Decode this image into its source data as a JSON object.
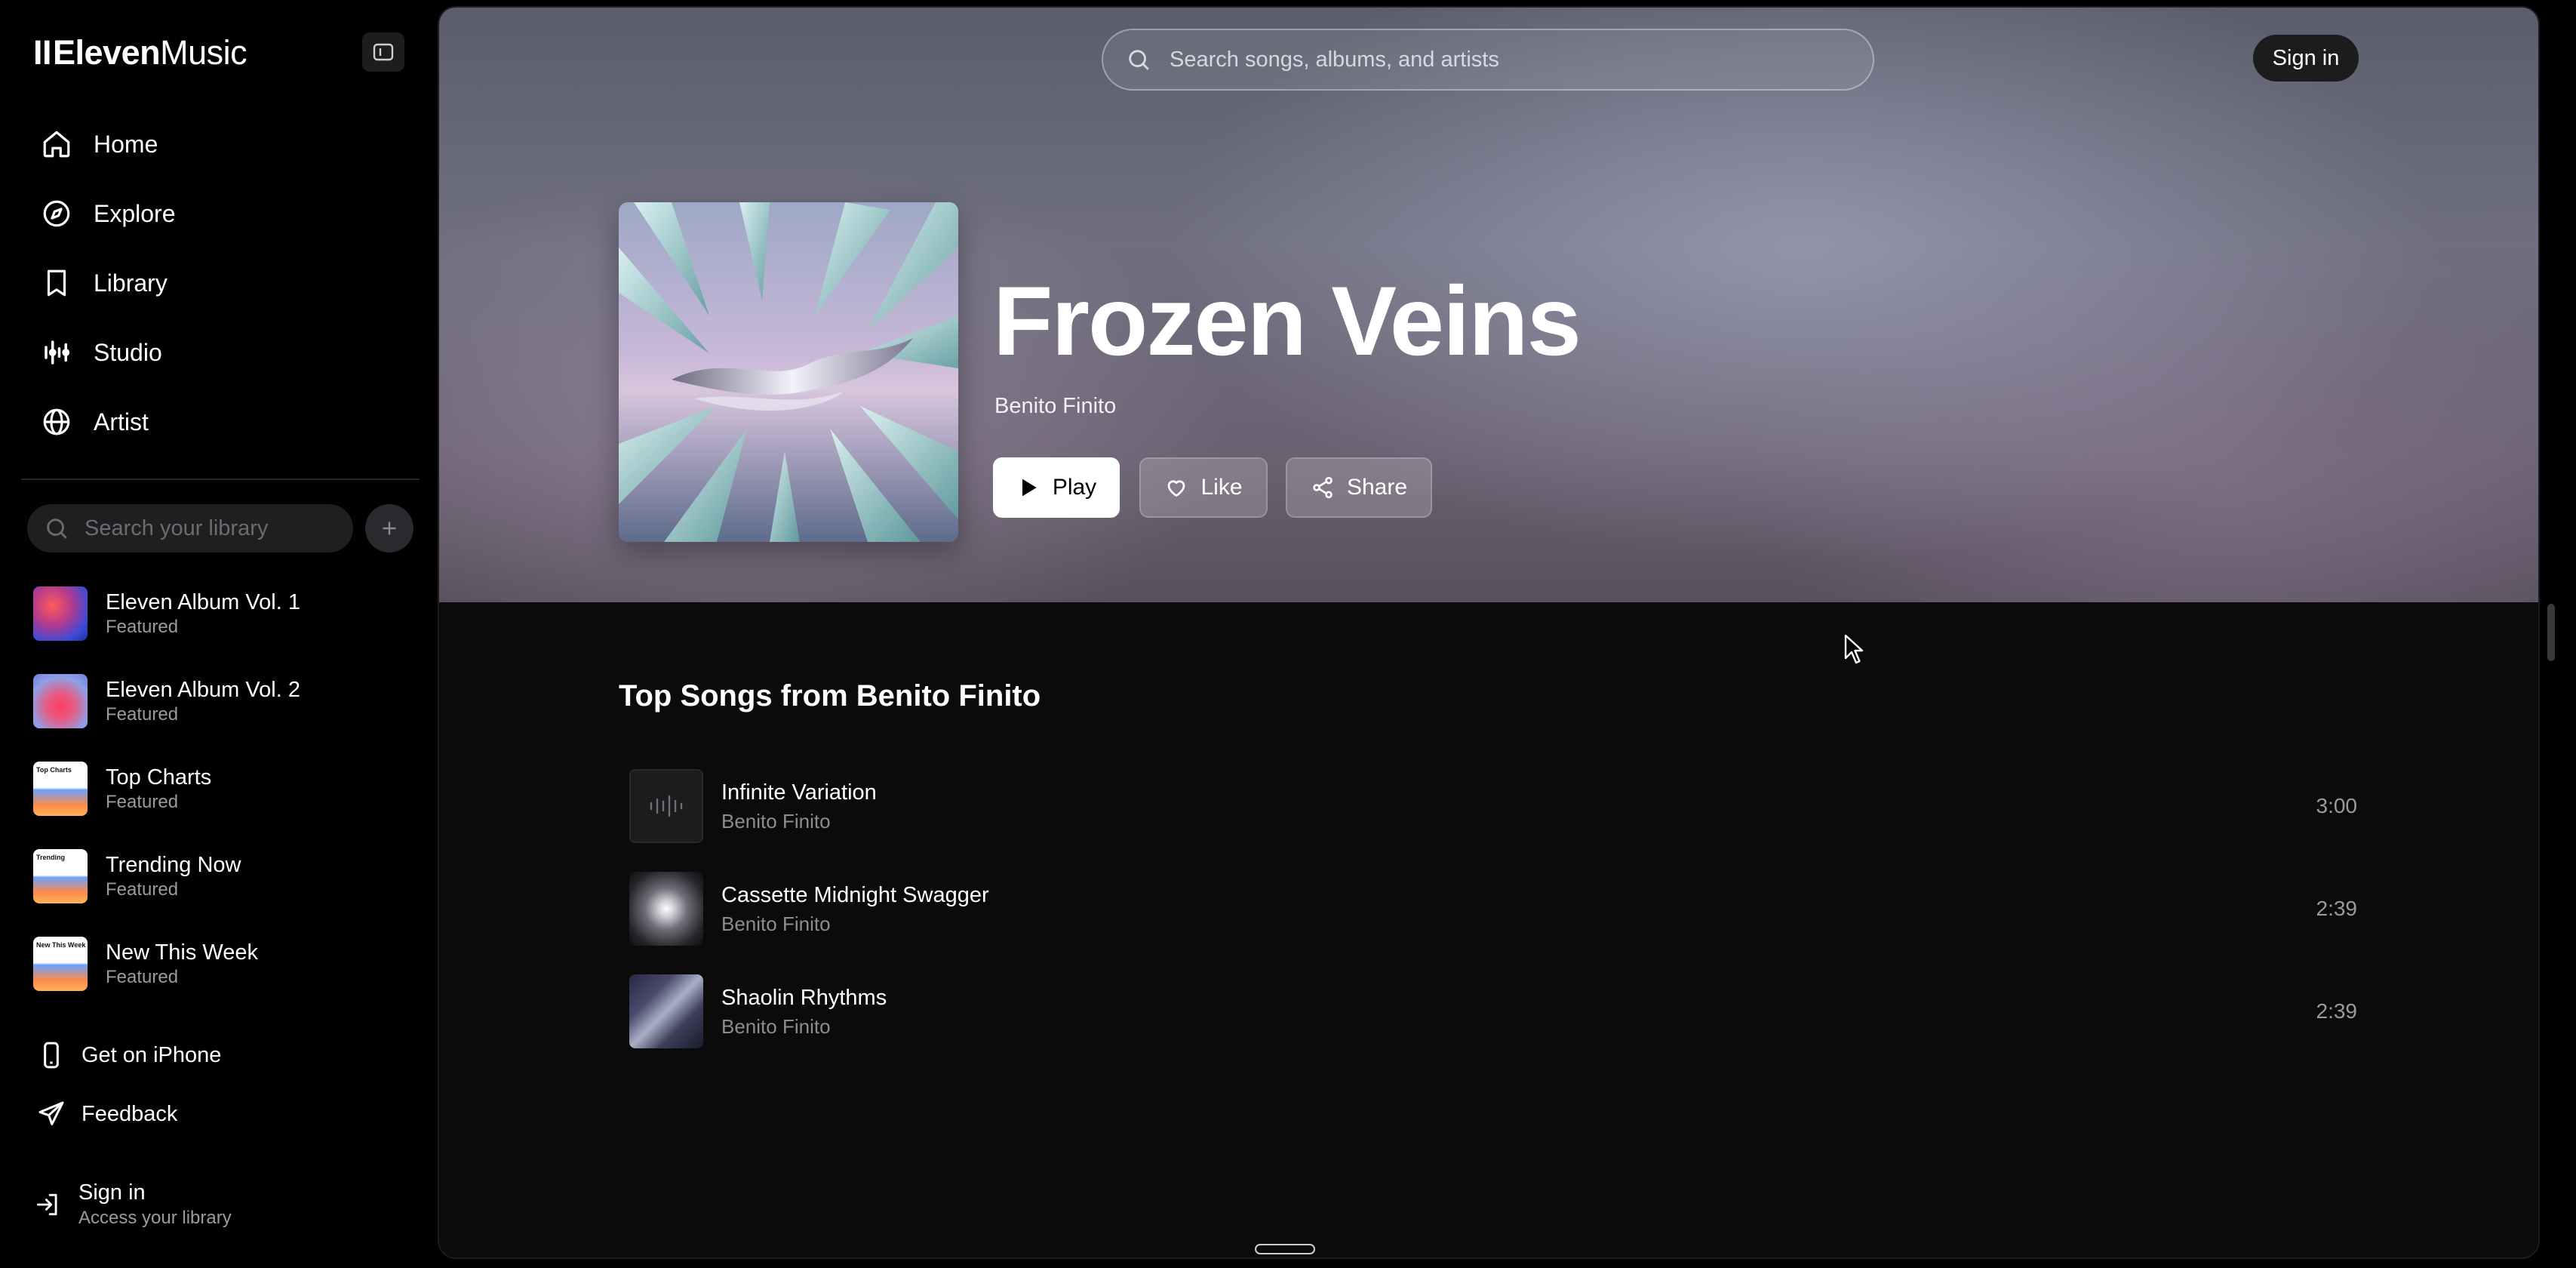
{
  "app": {
    "logo_bars": "II",
    "logo_bold": "Eleven",
    "logo_normal": "Music"
  },
  "sidebar": {
    "nav": [
      {
        "label": "Home",
        "icon": "home-icon"
      },
      {
        "label": "Explore",
        "icon": "compass-icon"
      },
      {
        "label": "Library",
        "icon": "bookmark-icon"
      },
      {
        "label": "Studio",
        "icon": "studio-icon"
      },
      {
        "label": "Artist",
        "icon": "globe-icon"
      }
    ],
    "library_search_placeholder": "Search your library",
    "library": [
      {
        "title": "Eleven Album Vol. 1",
        "subtitle": "Featured"
      },
      {
        "title": "Eleven Album Vol. 2",
        "subtitle": "Featured"
      },
      {
        "title": "Top Charts",
        "subtitle": "Featured",
        "thumb_text": "Top Charts"
      },
      {
        "title": "Trending Now",
        "subtitle": "Featured",
        "thumb_text": "Trending"
      },
      {
        "title": "New This Week",
        "subtitle": "Featured",
        "thumb_text": "New This Week"
      }
    ],
    "get_iphone": "Get on iPhone",
    "feedback": "Feedback",
    "signin_title": "Sign in",
    "signin_subtitle": "Access your library"
  },
  "header": {
    "search_placeholder": "Search songs, albums, and artists",
    "signin": "Sign in"
  },
  "album": {
    "title": "Frozen Veins",
    "artist": "Benito Finito",
    "play": "Play",
    "like": "Like",
    "share": "Share"
  },
  "top_songs": {
    "heading": "Top Songs from Benito Finito",
    "songs": [
      {
        "title": "Infinite Variation",
        "artist": "Benito Finito",
        "duration": "3:00"
      },
      {
        "title": "Cassette Midnight Swagger",
        "artist": "Benito Finito",
        "duration": "2:39"
      },
      {
        "title": "Shaolin Rhythms",
        "artist": "Benito Finito",
        "duration": "2:39"
      }
    ]
  },
  "colors": {
    "background": "#000000",
    "panel": "#0b0b0c",
    "text_muted": "#9a9aa0"
  }
}
